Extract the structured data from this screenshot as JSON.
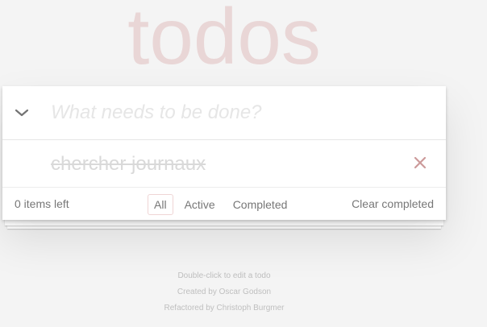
{
  "app": {
    "title": "todos"
  },
  "header": {
    "new_todo_placeholder": "What needs to be done?",
    "new_todo_value": ""
  },
  "todos": [
    {
      "text": "chercher journaux",
      "completed": true
    }
  ],
  "footer": {
    "count_text": "0 items left",
    "filters": [
      "All",
      "Active",
      "Completed"
    ],
    "selected_filter": "All",
    "clear_label": "Clear completed"
  },
  "info": {
    "line1": "Double-click to edit a todo",
    "line2": "Created by Oscar Godson",
    "line3": "Refactored by Christoph Burgmer"
  },
  "colors": {
    "background": "#f4f4f4",
    "title": "rgba(175,47,47,0.15)",
    "destroy": "#cc9a9a",
    "completed_text": "#d9d9d9",
    "check_green": "#5dc2af"
  },
  "icons": {
    "toggle_all": "chevron-down-icon",
    "complete": "checked-circle-icon",
    "destroy": "close-icon"
  }
}
